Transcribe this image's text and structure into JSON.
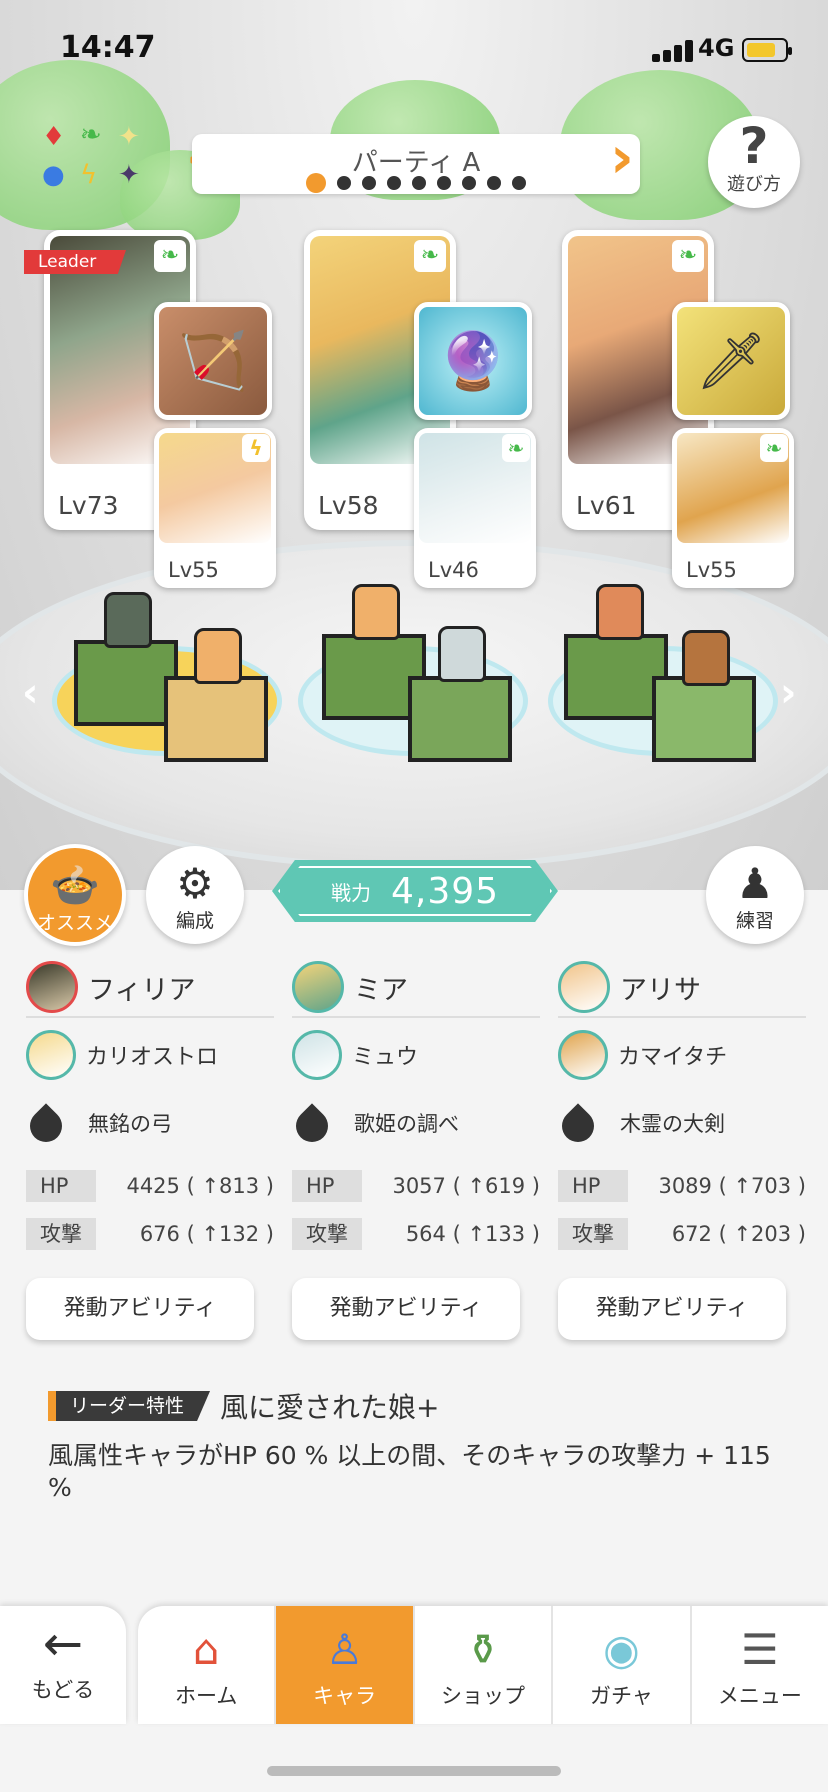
{
  "status_bar": {
    "time": "14:47",
    "network": "4G"
  },
  "party": {
    "title": "パーティ A",
    "page_count": 9,
    "current_page": 1
  },
  "help": {
    "label": "遊び方"
  },
  "units": [
    {
      "leader_badge": "Leader",
      "level": "Lv73",
      "sub_level": "Lv55",
      "element": "wind",
      "sub_element": "thunder",
      "weapon_icon": "bow-icon"
    },
    {
      "level": "Lv58",
      "sub_level": "Lv46",
      "element": "wind",
      "sub_element": "wind",
      "weapon_icon": "crystal-orb-icon"
    },
    {
      "level": "Lv61",
      "sub_level": "Lv55",
      "element": "wind",
      "sub_element": "wind",
      "weapon_icon": "greatsword-icon"
    }
  ],
  "actions": {
    "recommend": "オススメ",
    "formation": "編成",
    "practice": "練習"
  },
  "power": {
    "label": "戦力",
    "value": "4,395"
  },
  "columns": [
    {
      "main": "フィリア",
      "sub": "カリオストロ",
      "weapon": "無銘の弓",
      "hp_label": "HP",
      "hp": "4425 ( ↑813 )",
      "atk_label": "攻撃",
      "atk": "676 ( ↑132 )",
      "ability": "発動アビリティ"
    },
    {
      "main": "ミア",
      "sub": "ミュウ",
      "weapon": "歌姫の調べ",
      "hp_label": "HP",
      "hp": "3057 ( ↑619 )",
      "atk_label": "攻撃",
      "atk": "564 ( ↑133 )",
      "ability": "発動アビリティ"
    },
    {
      "main": "アリサ",
      "sub": "カマイタチ",
      "weapon": "木霊の大剣",
      "hp_label": "HP",
      "hp": "3089 ( ↑703 )",
      "atk_label": "攻撃",
      "atk": "672 ( ↑203 )",
      "ability": "発動アビリティ"
    }
  ],
  "leader_skill": {
    "tag": "リーダー特性",
    "name": "風に愛された娘+",
    "description": "風属性キャラがHP 60 % 以上の間、そのキャラの攻撃力 + 115 %"
  },
  "nav": {
    "back": "もどる",
    "tabs": [
      {
        "label": "ホーム",
        "icon": "home-icon",
        "active": false
      },
      {
        "label": "キャラ",
        "icon": "character-icon",
        "active": true
      },
      {
        "label": "ショップ",
        "icon": "shop-icon",
        "active": false
      },
      {
        "label": "ガチャ",
        "icon": "gacha-icon",
        "active": false
      },
      {
        "label": "メニュー",
        "icon": "menu-icon",
        "active": false
      }
    ]
  },
  "colors": {
    "accent": "#f29a2e",
    "teal": "#5fc7b4",
    "leader_red": "#e23a3a",
    "wind": "#46b94a",
    "thunder": "#f2c12e"
  }
}
